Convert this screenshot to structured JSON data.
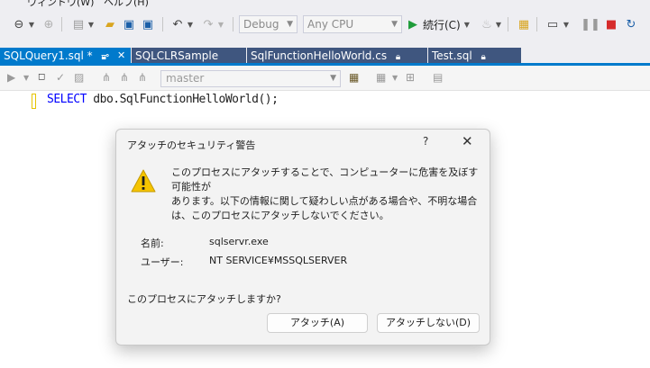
{
  "menu": {
    "window_label": "ウィンドウ(W)",
    "help_label": "ヘルプ(H)"
  },
  "toolbar": {
    "config_value": "Debug",
    "platform_value": "Any CPU",
    "continue_label": "続行(C)"
  },
  "tabs": [
    {
      "label": "SQLQuery1.sql *",
      "active": true
    },
    {
      "label": "SQLCLRSample",
      "active": false
    },
    {
      "label": "SqlFunctionHelloWorld.cs",
      "active": false
    },
    {
      "label": "Test.sql",
      "active": false
    }
  ],
  "editor_toolbar": {
    "database_value": "master"
  },
  "editor": {
    "keyword": "SELECT",
    "rest": " dbo.SqlFunctionHelloWorld();"
  },
  "dialog": {
    "title": "アタッチのセキュリティ警告",
    "help_symbol": "?",
    "close_symbol": "✕",
    "message_lines": [
      "このプロセスにアタッチすることで、コンピューターに危害を及ぼす可能性が",
      "あります。以下の情報に関して疑わしい点がある場合や、不明な場合",
      "は、このプロセスにアタッチしないでください。"
    ],
    "name_label": "名前:",
    "name_value": "sqlservr.exe",
    "user_label": "ユーザー:",
    "user_value": "NT SERVICE¥MSSQLSERVER",
    "question": "このプロセスにアタッチしますか?",
    "attach_button": "アタッチ(A)",
    "dont_attach_button": "アタッチしない(D)"
  },
  "colors": {
    "accent": "#007acc",
    "tab_inactive": "#3f567f",
    "sql_keyword": "#0000ff",
    "warning": "#f5c400"
  }
}
